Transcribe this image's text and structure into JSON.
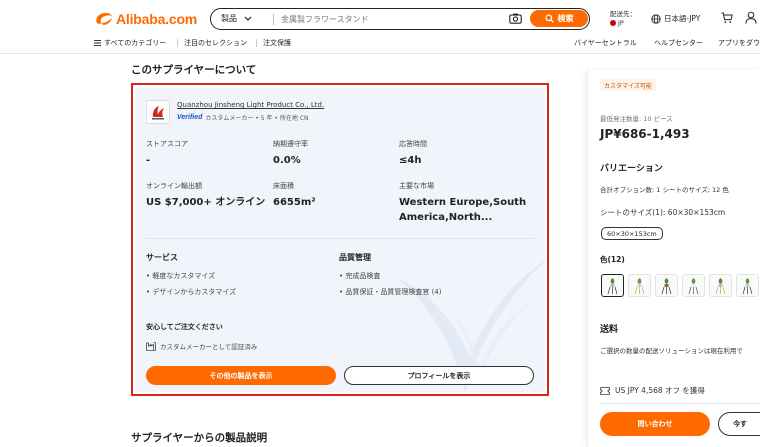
{
  "header": {
    "logo_text": "Alibaba.com",
    "search": {
      "category": "製品",
      "placeholder": "金属製フラワースタンド",
      "button": "検索"
    },
    "ship_to_label": "配送先：",
    "ship_to_country": "JP",
    "language": "日本語-JPY"
  },
  "nav": {
    "left": [
      "すべてのカテゴリー",
      "注目のセレクション",
      "注文保護"
    ],
    "right": [
      "バイヤーセントラル",
      "ヘルプセンター",
      "アプリをダウ"
    ]
  },
  "about": {
    "title": "このサプライヤーについて",
    "supplier_name": "Quanzhou Jinsheng Light Product Co., Ltd.",
    "verified": "Verified",
    "meta": "カスタムメーカー • 5 年 • 所在地 CN",
    "stats": [
      {
        "label": "ストアスコア",
        "value": "-"
      },
      {
        "label": "納期遵守率",
        "value": "0.0%"
      },
      {
        "label": "応答時間",
        "value": "≤4h"
      },
      {
        "label": "オンライン輸出額",
        "value": "US $7,000+ オンライン"
      },
      {
        "label": "床面積",
        "value": "6655m²"
      },
      {
        "label": "主要な市場",
        "value_line1": "Western Europe,South",
        "value_line2": "America,North..."
      }
    ],
    "services": {
      "title": "サービス",
      "items": [
        "• 軽度なカスタマイズ",
        "• デザインからカスタマイズ"
      ]
    },
    "quality": {
      "title": "品質管理",
      "items": [
        "• 完成品検査",
        "• 品質保証・品質管理検査官 (4)"
      ]
    },
    "rest_title": "安心してご注文ください",
    "rest_item": "カスタムメーカーとして認証済み",
    "btn_products": "その他の製品を表示",
    "btn_profile": "プロフィールを表示"
  },
  "description_title": "サプライヤーからの製品説明",
  "right_panel": {
    "badge": "カスタマイズ可能",
    "moq": "最低発注数量: 10 ピース",
    "price": "JP¥686-1,493",
    "variation_title": "バリエーション",
    "variation_summary": "合計オプション数: 1 シートのサイズ; 12 色",
    "size_label": "シートのサイズ(1): 60×30×153cm",
    "size_chip": "60×30×153cm",
    "color_label": "色(12)",
    "shipping_title": "送料",
    "shipping_text": "ご選択の数量の配送ソリューションは現在利用で",
    "coupon": "US JPY 4,568 オフ を獲得",
    "btn_inquiry": "問い合わせ",
    "btn_chat": "今す"
  },
  "colors": {
    "accent": "#ff6a00",
    "frame": "#d9251c",
    "verified": "#1a55c8"
  }
}
